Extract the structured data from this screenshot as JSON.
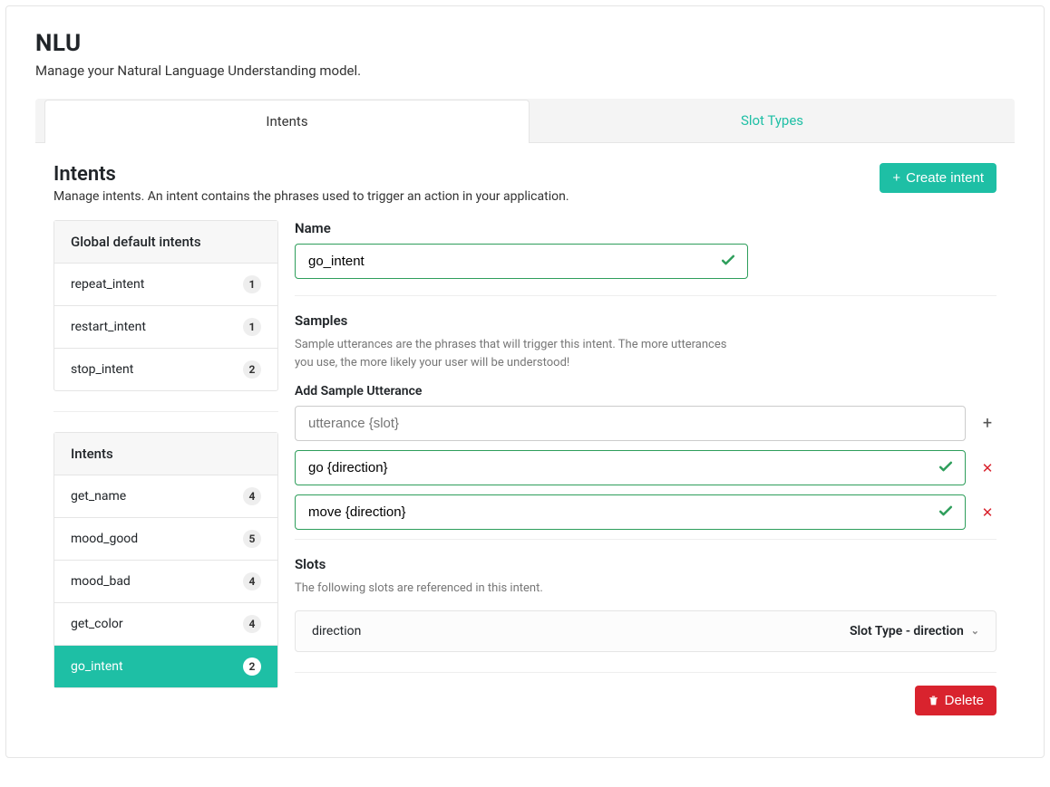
{
  "page": {
    "title": "NLU",
    "subtitle": "Manage your Natural Language Understanding model."
  },
  "tabs": {
    "intents": "Intents",
    "slot_types": "Slot Types"
  },
  "intents_panel": {
    "heading": "Intents",
    "description": "Manage intents. An intent contains the phrases used to trigger an action in your application.",
    "create_button": "Create intent"
  },
  "sidebar": {
    "global_header": "Global default intents",
    "global_items": [
      {
        "name": "repeat_intent",
        "count": "1"
      },
      {
        "name": "restart_intent",
        "count": "1"
      },
      {
        "name": "stop_intent",
        "count": "2"
      }
    ],
    "intents_header": "Intents",
    "intent_items": [
      {
        "name": "get_name",
        "count": "4",
        "active": false
      },
      {
        "name": "mood_good",
        "count": "5",
        "active": false
      },
      {
        "name": "mood_bad",
        "count": "4",
        "active": false
      },
      {
        "name": "get_color",
        "count": "4",
        "active": false
      },
      {
        "name": "go_intent",
        "count": "2",
        "active": true
      }
    ]
  },
  "detail": {
    "name_label": "Name",
    "name_value": "go_intent",
    "samples_heading": "Samples",
    "samples_helper": "Sample utterances are the phrases that will trigger this intent. The more utterances you use, the more likely your user will be understood!",
    "add_sample_label": "Add Sample Utterance",
    "add_sample_placeholder": "utterance {slot}",
    "samples": [
      {
        "text": "go {direction}"
      },
      {
        "text": "move {direction}"
      }
    ],
    "slots_heading": "Slots",
    "slots_helper": "The following slots are referenced in this intent.",
    "slot": {
      "name": "direction",
      "type_label": "Slot Type - direction"
    },
    "delete_button": "Delete"
  }
}
